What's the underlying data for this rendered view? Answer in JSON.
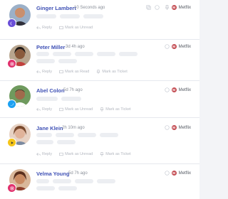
{
  "actions": {
    "reply": "Reply",
    "mark_unread": "Mark as Unread",
    "mark_read": "Mark as Read",
    "mark_ticket": "Mark as Ticket"
  },
  "brand": {
    "name": "Metflix",
    "logo_text": "M",
    "color": "#c44e54"
  },
  "colors": {
    "name_link": "#3f51b5",
    "skeleton": "#eceef2",
    "muted": "#8a8f99"
  },
  "cards": [
    {
      "name": "Ginger Lambert",
      "time": "10 Seconds ago",
      "source": "messenger-icon",
      "second_action": "Mark as Unread",
      "third_action": ""
    },
    {
      "name": "Peter Miller",
      "time": "3d 4h ago",
      "source": "instagram-icon",
      "second_action": "Mark as Read",
      "third_action": "Mark as Ticket"
    },
    {
      "name": "Abel Colon",
      "time": "5d 7h ago",
      "source": "twitter-icon",
      "second_action": "Mark as Unread",
      "third_action": "Mark as Ticket"
    },
    {
      "name": "Jane Klein",
      "time": "2h 10m ago",
      "source": "youtube-icon",
      "second_action": "Mark as Unread",
      "third_action": "Mark as Ticket"
    },
    {
      "name": "Velma Young",
      "time": "5d 7h ago",
      "source": "instagram-icon",
      "second_action": "",
      "third_action": ""
    }
  ]
}
